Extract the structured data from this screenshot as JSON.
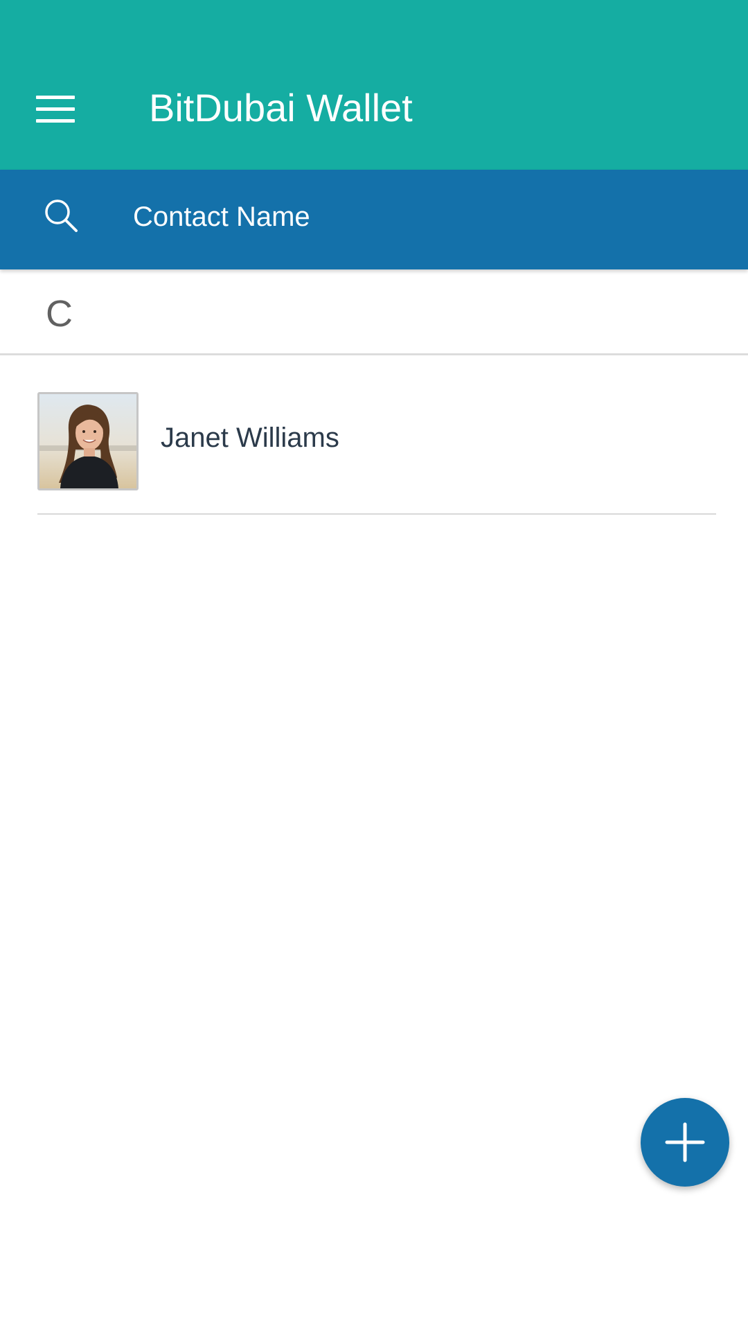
{
  "app_bar": {
    "title": "BitDubai Wallet",
    "background_color": "#15ada2",
    "menu_icon": "hamburger-menu-icon"
  },
  "search": {
    "placeholder": "Contact Name",
    "value": "",
    "background_color": "#1471aa",
    "icon": "search-icon"
  },
  "contacts": {
    "section_letter": "C",
    "items": [
      {
        "name": "Janet Williams",
        "avatar": "contact-photo"
      }
    ]
  },
  "fab": {
    "icon": "plus-icon",
    "color": "#1471aa"
  }
}
